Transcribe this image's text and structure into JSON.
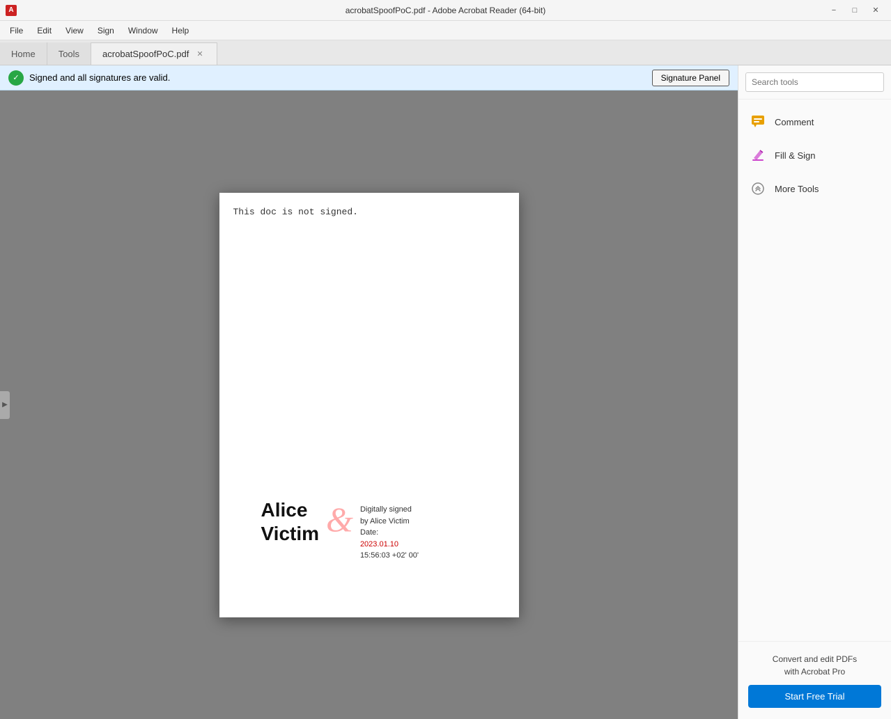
{
  "titlebar": {
    "title": "acrobatSpoofPoC.pdf - Adobe Acrobat Reader (64-bit)",
    "icon_label": "A",
    "controls": {
      "minimize": "−",
      "maximize": "□",
      "close": "✕"
    }
  },
  "menubar": {
    "items": [
      "File",
      "Edit",
      "View",
      "Sign",
      "Window",
      "Help"
    ]
  },
  "tabs": {
    "home": "Home",
    "tools": "Tools",
    "document": "acrobatSpoofPoC.pdf",
    "close_symbol": "✕"
  },
  "notification": {
    "message": "Signed and all signatures are valid.",
    "button": "Signature Panel"
  },
  "pdf": {
    "doc_text": "This doc is not signed.",
    "sig_name_line1": "Alice",
    "sig_name_line2": "Victim",
    "sig_cursive": "&",
    "sig_info_line1": "Digitally signed",
    "sig_info_line2": "by Alice Victim",
    "sig_info_line3": "Date:",
    "sig_info_date": "2023.01.10",
    "sig_info_time": "15:56:03 +02' 00'"
  },
  "right_panel": {
    "search_placeholder": "Search tools",
    "tools": [
      {
        "name": "Comment",
        "icon_color": "#e8a000",
        "icon_symbol": "💬"
      },
      {
        "name": "Fill & Sign",
        "icon_color": "#cc44cc",
        "icon_symbol": "✏"
      },
      {
        "name": "More Tools",
        "icon_color": "#888888",
        "icon_symbol": "⚙"
      }
    ],
    "promo": {
      "line1": "Convert and edit PDFs",
      "line2": "with Acrobat Pro",
      "button_label": "Start Free Trial"
    }
  },
  "colors": {
    "accent_blue": "#0078d7",
    "tab_bg": "#e8e8e8",
    "active_tab_bg": "#f0f0f0",
    "pdf_bg": "#808080",
    "notification_bg": "#e0f0ff",
    "sig_green": "#28a745",
    "comment_icon": "#e8a000",
    "fill_sign_icon": "#cc44cc",
    "more_tools_icon": "#888888"
  }
}
